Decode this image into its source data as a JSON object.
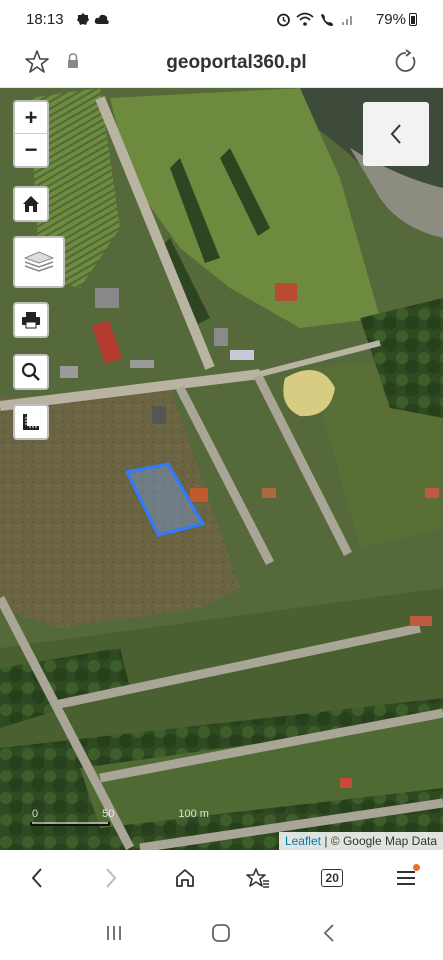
{
  "status_bar": {
    "time": "18:13",
    "battery_percent": "79%"
  },
  "url_bar": {
    "url": "geoportal360.pl"
  },
  "map": {
    "zoom_in_label": "+",
    "zoom_out_label": "−",
    "scale_labels": [
      "0",
      "50",
      "100 m"
    ],
    "attribution_link": "Leaflet",
    "attribution_text": " | © Google Map Data",
    "parcel_color": "#2f7bff"
  },
  "toolbar": {
    "tabs_count": "20"
  }
}
